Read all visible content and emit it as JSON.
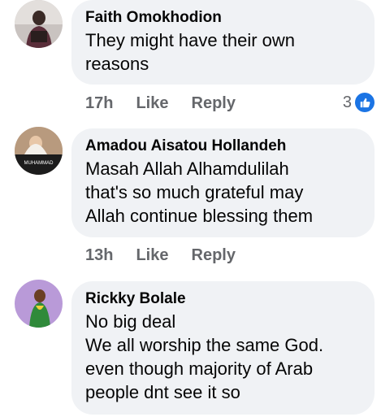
{
  "comments": [
    {
      "author": "Faith Omokhodion",
      "text": "They  might have their own\nreasons",
      "time": "17h",
      "like_label": "Like",
      "reply_label": "Reply",
      "reaction_count": "3",
      "reaction_icon": "like-icon",
      "avatar": "user-photo"
    },
    {
      "author": "Amadou Aisatou Hollandeh",
      "text": "Masah Allah   Alhamdulilah\nthat's so much grateful may\nAllah continue blessing them",
      "time": "13h",
      "like_label": "Like",
      "reply_label": "Reply",
      "avatar": "user-photo",
      "avatar_text": "MUHAMMAD"
    },
    {
      "author": "Rickky Bolale",
      "text": "No big deal\nWe all worship the same God.\neven though majority of Arab\npeople dnt see it so",
      "avatar": "user-photo"
    }
  ],
  "colors": {
    "bubble": "#f0f2f5",
    "secondary_text": "#65676b",
    "like_blue": "#1b74e4"
  }
}
